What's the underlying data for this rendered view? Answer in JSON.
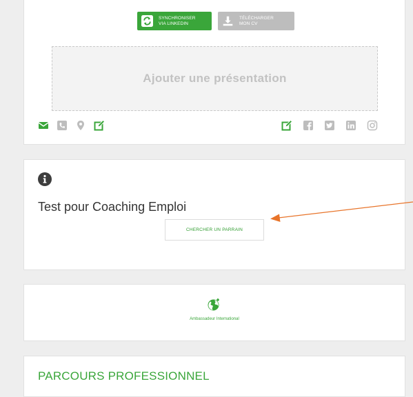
{
  "profile": {
    "sync_button": {
      "line1": "SYNCHRONISER",
      "line2": "VIA LINKEDIN",
      "icon": "sync-icon"
    },
    "cv_button": {
      "line1": "TÉLÉCHARGER",
      "line2": "MON CV",
      "icon": "download-icon"
    },
    "presentation_placeholder": "Ajouter une présentation",
    "contact_icons": [
      "envelope-icon",
      "phone-icon",
      "map-marker-icon",
      "edit-icon"
    ],
    "social_icons": [
      "edit-icon",
      "facebook-icon",
      "twitter-icon",
      "linkedin-icon",
      "instagram-icon"
    ]
  },
  "test_card": {
    "icon": "info-icon",
    "title": "Test pour Coaching Emploi",
    "button": "CHERCHER UN PARRAIN"
  },
  "ambassador": {
    "icon": "globe-icon",
    "label": "Ambassadeur International"
  },
  "parcours": {
    "title": "PARCOURS PROFESSIONNEL"
  },
  "colors": {
    "green": "#3aa63a",
    "grey_button": "#bdbdbd",
    "arrow": "#e8742a",
    "inactive_icon": "#bdbdbd"
  }
}
